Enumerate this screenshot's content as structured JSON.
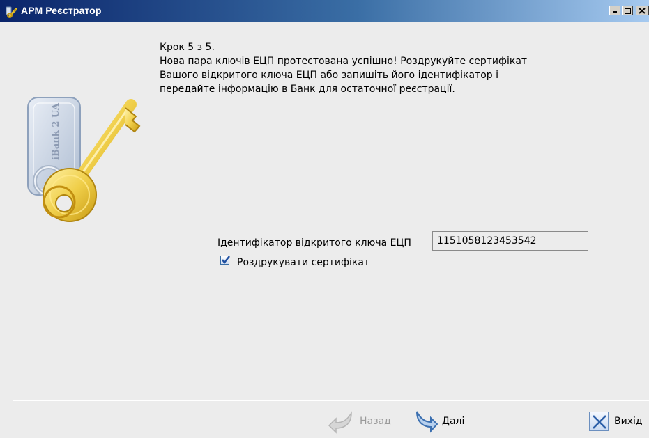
{
  "window": {
    "title": "АРМ Реєстратор"
  },
  "logo": {
    "text": "iBank 2 UA",
    "icon": "key-icon"
  },
  "wizard": {
    "step": "Крок 5 з 5.",
    "message_lines": [
      "Нова пара ключів ЕЦП протестована успішно! Роздрукуйте сертифікат",
      "Вашого відкритого ключа ЕЦП або запишіть його ідентифікатор і",
      "передайте інформацію в Банк для остаточної реєстрації."
    ]
  },
  "form": {
    "key_id_label": "Ідентифікатор відкритого ключа ЕЦП",
    "key_id_value": "1151058123453542",
    "print_checkbox_label": "Роздрукувати сертифікат",
    "print_checked": true
  },
  "buttons": {
    "back": "Назад",
    "next": "Далі",
    "exit": "Вихід"
  },
  "colors": {
    "title_start": "#0a246a",
    "title_end": "#a6caf0",
    "background": "#ececec",
    "accent": "#3a6ea5"
  }
}
